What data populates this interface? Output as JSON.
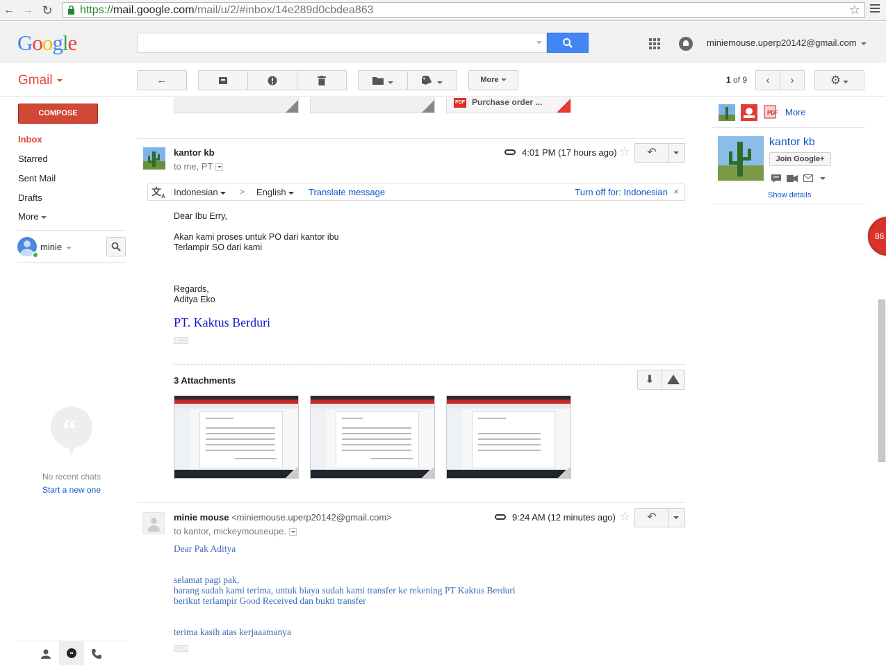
{
  "browser": {
    "url_scheme": "https://",
    "url_host": "mail.google.com",
    "url_path": "/mail/u/2/#inbox/14e289d0cbdea863"
  },
  "header": {
    "logo_letters": [
      "G",
      "o",
      "o",
      "g",
      "l",
      "e"
    ],
    "account": "miniemouse.uperp20142@gmail.com",
    "search_placeholder": ""
  },
  "toolbar": {
    "app_label": "Gmail",
    "more_label": "More",
    "pager_current": "1",
    "pager_of": "of",
    "pager_total": "9"
  },
  "sidebar": {
    "compose": "COMPOSE",
    "items": [
      {
        "label": "Inbox",
        "active": true
      },
      {
        "label": "Starred"
      },
      {
        "label": "Sent Mail"
      },
      {
        "label": "Drafts"
      },
      {
        "label": "More"
      }
    ],
    "user": "minie",
    "no_chats": "No recent chats",
    "start_new": "Start a new one"
  },
  "thread": {
    "top_attachment_name": "Purchase order ...",
    "top_attachment_type": "PDF",
    "messages": [
      {
        "sender": "kantor kb",
        "to": "to me, PT",
        "time": "4:01 PM (17 hours ago)",
        "translate": {
          "source": "Indonesian",
          "arrow": ">",
          "target": "English",
          "action": "Translate message",
          "turn_off": "Turn off for: Indonesian",
          "close": "×"
        },
        "body": [
          "Dear Ibu Erry,",
          "Akan kami proses untuk PO dari kantor ibu",
          "Terlampir SO dari kami",
          "Regards,",
          "Aditya Eko"
        ],
        "signature": "PT. Kaktus Berduri",
        "attachments_title": "3 Attachments",
        "attachments": [
          "attachment-1",
          "attachment-2",
          "attachment-3"
        ]
      },
      {
        "sender": "minie mouse",
        "sender_email": "<miniemouse.uperp20142@gmail.com>",
        "to": "to kantor, mickeymouseupe.",
        "time": "9:24 AM (12 minutes ago)",
        "body": [
          "Dear Pak Aditya",
          "selamat pagi pak,",
          "barang sudah kami terima, untuk biaya sudah kami transfer ke rekening PT Kaktus Berduri",
          "berikut terlampir Good Received dan bukti transfer",
          "terima kasih atas kerjaaamanya"
        ]
      }
    ]
  },
  "right_panel": {
    "more": "More",
    "contact_name": "kantor kb",
    "join_button": "Join Google+",
    "show_details": "Show details",
    "badge_count": "86"
  },
  "colors": {
    "gmail_red": "#dd4b39",
    "compose_red": "#d14836",
    "link_blue": "#1155cc",
    "search_blue": "#4285f4"
  }
}
